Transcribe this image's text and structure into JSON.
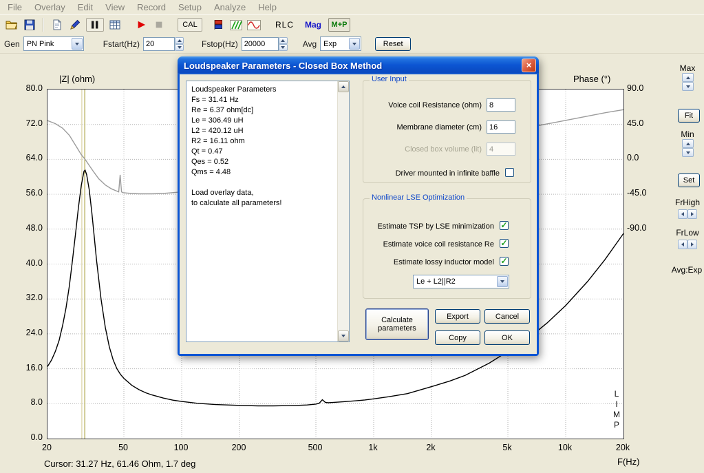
{
  "menu": {
    "items": [
      "File",
      "Overlay",
      "Edit",
      "View",
      "Record",
      "Setup",
      "Analyze",
      "Help"
    ]
  },
  "toolbar": {
    "cal_label": "CAL",
    "rlc_label": "RLC",
    "mag_label": "Mag",
    "mp_label": "M+P"
  },
  "generator": {
    "gen_label": "Gen",
    "gen_value": "PN Pink",
    "fstart_label": "Fstart(Hz)",
    "fstart_value": "20",
    "fstop_label": "Fstop(Hz)",
    "fstop_value": "20000",
    "avg_label": "Avg",
    "avg_value": "Exp",
    "reset_label": "Reset"
  },
  "scale_panel": {
    "max_label": "Max",
    "fit_label": "Fit",
    "min_label": "Min",
    "set_label": "Set",
    "frhigh_label": "FrHigh",
    "frlow_label": "FrLow",
    "avg_text": "Avg:Exp"
  },
  "status": {
    "cursor_text": "Cursor: 31.27 Hz, 61.46 Ohm, 1.7 deg"
  },
  "chart_data": {
    "type": "line",
    "x_scale": "log",
    "xlabel": "F(Hz)",
    "left_axis_title": "|Z| (ohm)",
    "right_axis_title": "Phase (°)",
    "xlim": [
      20,
      20000
    ],
    "ylim_left": [
      0,
      80
    ],
    "ylim_right_deg": [
      -90,
      90
    ],
    "x_ticks": [
      {
        "v": 20,
        "t": "20"
      },
      {
        "v": 50,
        "t": "50"
      },
      {
        "v": 100,
        "t": "100"
      },
      {
        "v": 200,
        "t": "200"
      },
      {
        "v": 500,
        "t": "500"
      },
      {
        "v": 1000,
        "t": "1k"
      },
      {
        "v": 2000,
        "t": "2k"
      },
      {
        "v": 5000,
        "t": "5k"
      },
      {
        "v": 10000,
        "t": "10k"
      },
      {
        "v": 20000,
        "t": "20k"
      }
    ],
    "y_ticks_left": [
      80,
      72,
      64,
      56,
      48,
      40,
      32,
      24,
      16,
      8,
      0
    ],
    "y_ticks_right": [
      90,
      45,
      0,
      -45,
      -90
    ],
    "phase_map": {
      "center_ohm": 64,
      "ohm_per_deg": 0.17778
    },
    "cursor": {
      "freq_hz": 31.27,
      "impedance_ohm": 61.46,
      "phase_deg": 1.7
    },
    "marker_freq_hz": 30.2,
    "colors": {
      "impedance": "#000000",
      "phase": "#9c9c9c",
      "cursor": "#998f1e",
      "marker": "#d2c98f",
      "grid": "#b4b4b4"
    },
    "watermark": "LIMP",
    "series": [
      {
        "name": "impedance",
        "unit": "ohm",
        "color": "#000000",
        "x": [
          20,
          21,
          22,
          23,
          24,
          25,
          26,
          27,
          28,
          29,
          30,
          31,
          31.4,
          32,
          33,
          34,
          35,
          36,
          38,
          40,
          42,
          44,
          46,
          48,
          50,
          55,
          60,
          65,
          70,
          80,
          90,
          100,
          120,
          150,
          200,
          250,
          300,
          350,
          400,
          450,
          500,
          520,
          540,
          560,
          580,
          600,
          650,
          700,
          800,
          900,
          1000,
          1200,
          1500,
          2000,
          2500,
          3000,
          4000,
          5000,
          6000,
          8000,
          10000,
          13000,
          16000,
          20000
        ],
        "y": [
          16.5,
          18,
          20,
          22.5,
          26,
          30,
          35,
          41,
          47,
          53,
          58,
          61.3,
          61.5,
          60.5,
          57,
          52,
          46.5,
          41,
          32,
          25.5,
          21,
          18,
          16,
          14.7,
          13.8,
          12.2,
          11.2,
          10.5,
          10,
          9.3,
          8.8,
          8.5,
          8.1,
          7.8,
          7.6,
          7.5,
          7.5,
          7.55,
          7.6,
          7.7,
          7.9,
          8.1,
          8.9,
          8.3,
          8.2,
          8.25,
          8.35,
          8.45,
          8.65,
          8.85,
          9.1,
          9.6,
          10.3,
          11.9,
          13.2,
          14.5,
          17.3,
          20,
          22,
          26.5,
          30.5,
          36,
          41,
          47
        ]
      },
      {
        "name": "phase",
        "unit": "deg",
        "color": "#9c9c9c",
        "x": [
          20,
          22,
          24,
          26,
          28,
          30,
          31.4,
          33,
          35,
          37,
          40,
          43,
          46,
          47,
          47.8,
          48.6,
          49.5,
          52,
          55,
          60,
          70,
          80,
          100,
          120,
          150,
          200,
          250,
          300,
          400,
          500,
          520,
          540,
          560,
          600,
          700,
          800,
          1000,
          1300,
          1700,
          2200,
          3000,
          4000,
          5000,
          7000,
          9000,
          12000,
          16000,
          20000
        ],
        "y": [
          50,
          46,
          40,
          31,
          18,
          6,
          0,
          -8,
          -17,
          -25,
          -33,
          -38,
          -41,
          -42,
          -20,
          -42,
          -43,
          -43.5,
          -44,
          -44.5,
          -44.5,
          -44,
          -42,
          -40,
          -37,
          -32,
          -28,
          -25,
          -19,
          -14,
          -13,
          -20,
          -11,
          -10,
          -6,
          -3,
          1,
          6,
          12,
          18,
          25,
          31,
          36,
          43,
          48,
          54,
          60,
          64
        ]
      }
    ]
  },
  "dialog": {
    "title": "Loudspeaker Parameters - Closed Box Method",
    "params_text": [
      "Loudspeaker Parameters",
      "Fs = 31.41 Hz",
      "Re = 6.37 ohm[dc]",
      "Le = 306.49 uH",
      "L2 = 420.12 uH",
      "R2 = 16.11 ohm",
      "Qt = 0.47",
      "Qes = 0.52",
      "Qms = 4.48",
      "",
      "Load overlay data,",
      "to calculate all parameters!"
    ],
    "user_input": {
      "caption": "User Input",
      "rows": [
        {
          "label": "Voice coil Resistance (ohm)",
          "value": "8"
        },
        {
          "label": "Membrane diameter (cm)",
          "value": "16"
        },
        {
          "label": "Closed box volume (lit)",
          "value": "4"
        }
      ],
      "baffle_label": "Driver mounted in infinite baffle",
      "baffle_checked": false
    },
    "lse": {
      "caption": "Nonlinear LSE Optimization",
      "checkboxes": [
        {
          "label": "Estimate TSP by LSE minimization",
          "checked": true
        },
        {
          "label": "Estimate voice coil resistance Re",
          "checked": true
        },
        {
          "label": "Estimate lossy inductor model",
          "checked": true
        }
      ],
      "inductor_model_value": "Le + L2||R2"
    },
    "buttons": {
      "calculate": "Calculate parameters",
      "export": "Export",
      "cancel": "Cancel",
      "copy": "Copy",
      "ok": "OK"
    }
  }
}
